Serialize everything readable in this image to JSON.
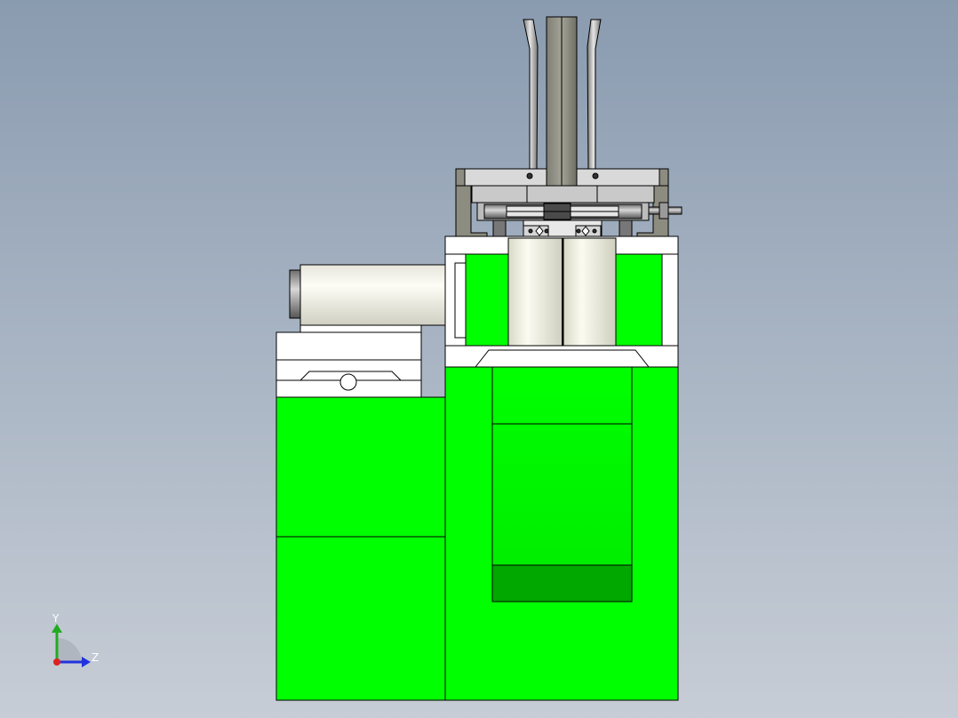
{
  "viewport": {
    "background_top": "#8a9bb0",
    "background_bottom": "#c7cdd6"
  },
  "model": {
    "body_color": "#00ff00",
    "body_shadow_color": "#00a800",
    "part_color": "#ffffff",
    "steel_color": "#8c8c80",
    "cylinder_color": "#f2f2e6",
    "edge_color": "#000000"
  },
  "triad": {
    "y_label": "Y",
    "z_label": "Z",
    "y_color": "#22aa22",
    "z_color": "#2233dd",
    "x_color": "#dd2222"
  }
}
